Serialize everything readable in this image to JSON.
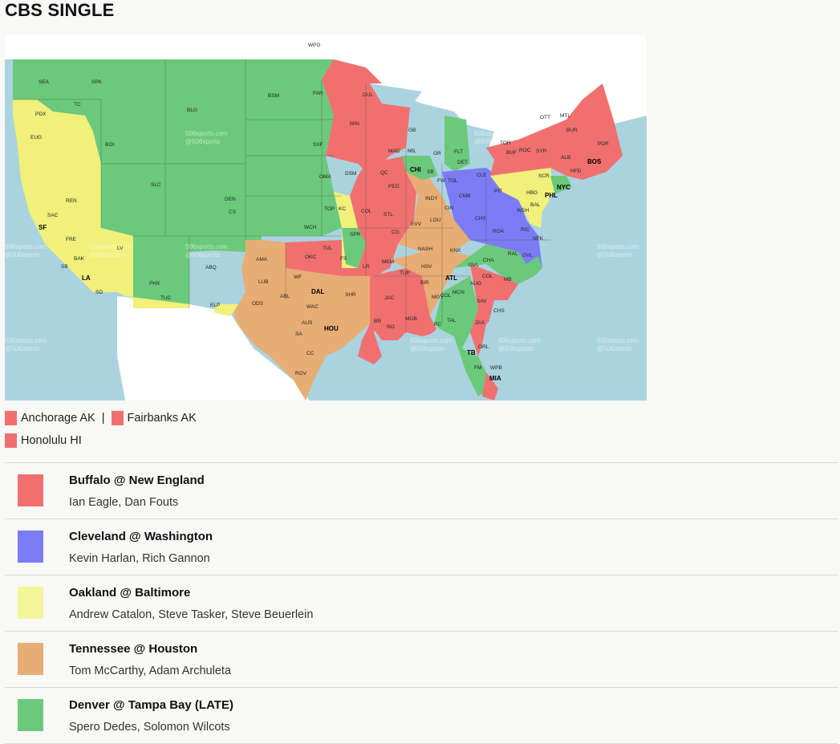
{
  "page_title": "CBS SINGLE",
  "colors": {
    "red": "#f07070",
    "blue": "#7b7cf5",
    "yellow": "#f0f07a",
    "orange": "#e8ad74",
    "green": "#6bc97b",
    "ocean": "#aad3df",
    "land": "#ffffff"
  },
  "map": {
    "watermark": [
      "506sports.com",
      "@506sports"
    ],
    "cities": [
      "SEA",
      "SPK",
      "TC",
      "PDX",
      "EUG",
      "BOI",
      "BLG",
      "BSM",
      "FAR",
      "DUL",
      "MIN",
      "SLC",
      "DEN",
      "CS",
      "SXF",
      "OMA",
      "DSM",
      "LAX",
      "SF",
      "SAC",
      "REN",
      "FRE",
      "BAK",
      "SB",
      "LV",
      "PHX",
      "TUC",
      "SD",
      "ABQ",
      "ELP",
      "AMA",
      "LUB",
      "ODS",
      "ABL",
      "WF",
      "DAL",
      "WAC",
      "AUS",
      "SA",
      "HOU",
      "CC",
      "RGV",
      "OKC",
      "TUL",
      "FS",
      "LR",
      "SHR",
      "WCH",
      "TOP",
      "KC",
      "COL",
      "SPR",
      "STL",
      "PEO",
      "QC",
      "MAD",
      "MIL",
      "GB",
      "CHI",
      "SB",
      "FW",
      "INDY",
      "CG",
      "EVV",
      "LOU",
      "NASH",
      "MEM",
      "TUP",
      "HSV",
      "BIR",
      "JAC",
      "MGY",
      "COL",
      "MOB",
      "NO",
      "BR",
      "PC",
      "TAL",
      "ATL",
      "MCN",
      "AUG",
      "SAV",
      "JAX",
      "ORL",
      "TB",
      "FM",
      "WPB",
      "MIA",
      "GVL",
      "CHA",
      "KNX",
      "COL",
      "CHS",
      "MB",
      "RAL",
      "GVL",
      "NFK",
      "RIC",
      "ROA",
      "CHS",
      "CIN",
      "CMB",
      "CLE",
      "DET",
      "FLT",
      "GR",
      "TOL",
      "PIT",
      "WSH",
      "BAL",
      "HBG",
      "PHL",
      "NYC",
      "SCR",
      "BUF",
      "ROC",
      "SYR",
      "ALB",
      "HFD",
      "BOS",
      "PDR",
      "BUR",
      "MTL",
      "OTT",
      "TOR",
      "WPG"
    ],
    "big_cities": [
      "SF",
      "LA",
      "DAL",
      "HOU",
      "CHI",
      "ATL",
      "TB",
      "MIA",
      "PHL",
      "NYC",
      "BOS"
    ]
  },
  "alaska_hawaii": [
    {
      "label": "Anchorage AK",
      "color": "#f07070"
    },
    {
      "label": "Fairbanks AK",
      "color": "#f07070"
    },
    {
      "label": "Honolulu HI",
      "color": "#f07070"
    }
  ],
  "separator": "|",
  "games": [
    {
      "matchup": "Buffalo @ New England",
      "crew": "Ian Eagle, Dan Fouts",
      "color": "#f07070"
    },
    {
      "matchup": "Cleveland @ Washington",
      "crew": "Kevin Harlan, Rich Gannon",
      "color": "#7b7cf5"
    },
    {
      "matchup": "Oakland @ Baltimore",
      "crew": "Andrew Catalon, Steve Tasker, Steve Beuerlein",
      "color": "#f5f59a"
    },
    {
      "matchup": "Tennessee @ Houston",
      "crew": "Tom McCarthy, Adam Archuleta",
      "color": "#e8ad74"
    },
    {
      "matchup": "Denver @ Tampa Bay (LATE)",
      "crew": "Spero Dedes, Solomon Wilcots",
      "color": "#6bc97b"
    }
  ]
}
